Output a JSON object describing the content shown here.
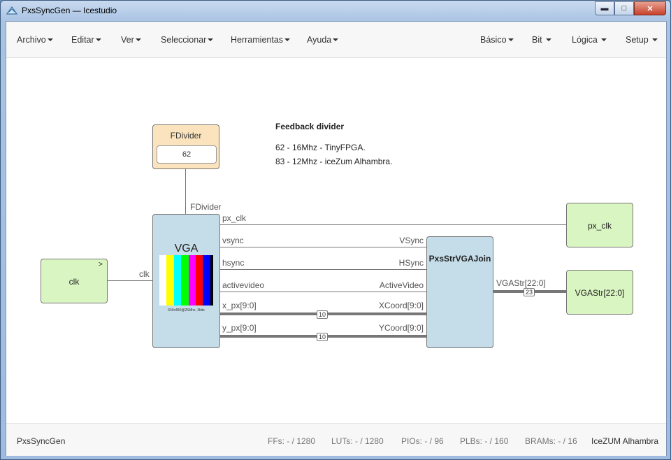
{
  "window": {
    "title": "PxsSyncGen — Icestudio",
    "icon": "icestudio-logo-icon",
    "buttons": {
      "minimize": "▬",
      "maximize": "□",
      "close": "✕"
    }
  },
  "menu": {
    "left": [
      "Archivo",
      "Editar",
      "Ver",
      "Seleccionar",
      "Herramientas",
      "Ayuda"
    ],
    "right": [
      "Básico",
      "Bit",
      "Lógica",
      "Setup"
    ]
  },
  "canvas": {
    "fdivider": {
      "title": "FDivider",
      "value": "62",
      "port": "FDivider"
    },
    "note": {
      "title": "Feedback divider",
      "lines": [
        "62 - 16Mhz - TinyFPGA.",
        "83 - 12Mhz - iceZum Alhambra."
      ]
    },
    "clk_input": {
      "label": "clk",
      "clock_mark": ">"
    },
    "vga": {
      "title": "VGA",
      "subtitle": "640x480@25Mhz, 3bits",
      "in_port": "clk",
      "out_ports": [
        "px_clk",
        "vsync",
        "hsync",
        "activevideo",
        "x_px[9:0]",
        "y_px[9:0]"
      ],
      "bar_colors": [
        "#ffff00",
        "#00ffff",
        "#00ff00",
        "#ff00ff",
        "#ff0000",
        "#0000ff"
      ]
    },
    "join": {
      "title": "PxsStrVGAJoin",
      "in_ports": [
        "VSync",
        "HSync",
        "ActiveVideo",
        "XCoord[9:0]",
        "YCoord[9:0]"
      ],
      "out_port": "VGAStr[22:0]"
    },
    "bus_widths": {
      "x": "10",
      "y": "10",
      "vgastr": "23"
    },
    "outputs": {
      "px_clk": "px_clk",
      "vgastr": "VGAStr[22:0]"
    }
  },
  "footer": {
    "project": "PxsSyncGen",
    "ffs": "FFs:  - / 1280",
    "luts": "LUTs:  - / 1280",
    "pios": "PIOs:  - / 96",
    "plbs": "PLBs:  - / 160",
    "brams": "BRAMs:  - / 16",
    "board": "IceZUM Alhambra"
  }
}
